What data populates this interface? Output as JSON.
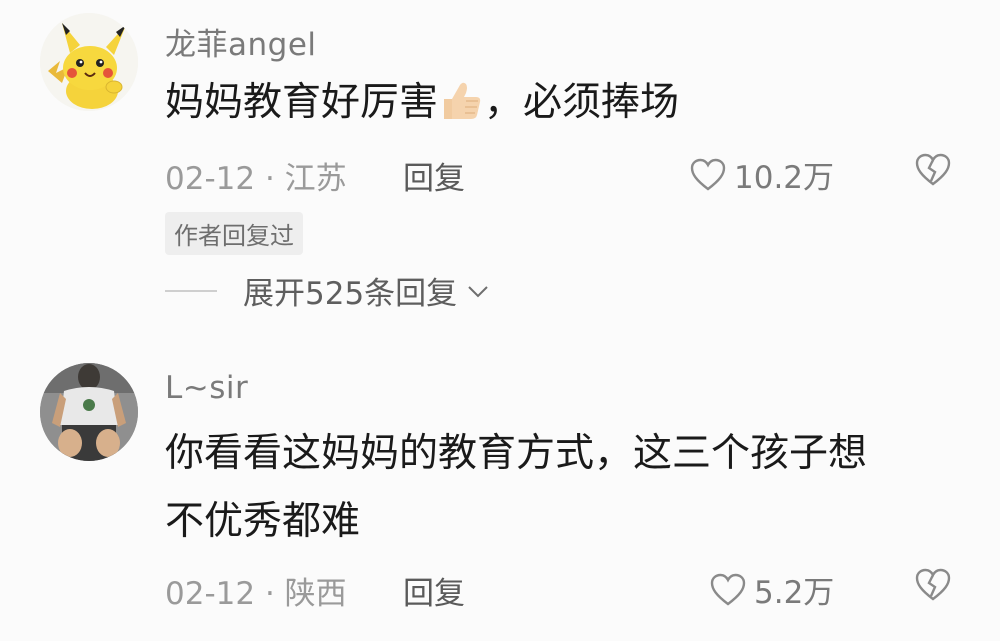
{
  "comments": [
    {
      "username": "龙菲angel",
      "text_before_emoji": "妈妈教育好厉害",
      "emoji": "thumbs-up-emoji",
      "text_after_emoji": "，必须捧场",
      "date": "02-12",
      "separator": "·",
      "location": "江苏",
      "reply_label": "回复",
      "like_count": "10.2万",
      "author_badge": "作者回复过",
      "expand_label": "展开525条回复"
    },
    {
      "username": "L~sir",
      "text_line1": "你看看这妈妈的教育方式，这三个孩子想",
      "text_line2": "不优秀都难",
      "date": "02-12",
      "separator": "·",
      "location": "陕西",
      "reply_label": "回复",
      "like_count": "5.2万"
    }
  ],
  "icons": {
    "like": "heart-outline-icon",
    "dislike": "broken-heart-icon",
    "expand": "chevron-down-icon"
  },
  "colors": {
    "background": "#fbfbfb",
    "text_primary": "#1a1a1a",
    "text_secondary": "#9a9a9a"
  }
}
